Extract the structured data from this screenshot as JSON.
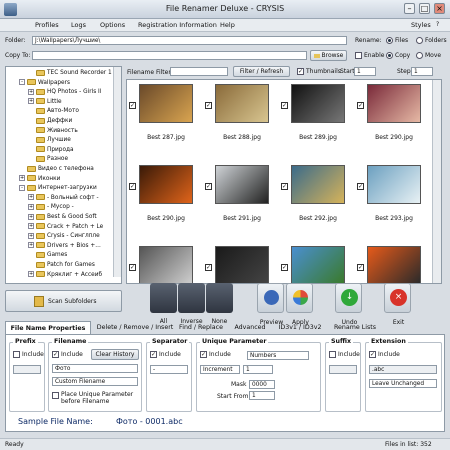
{
  "window": {
    "title": "File Renamer Deluxe - CRYSIS"
  },
  "menu": [
    "Profiles",
    "Logs",
    "Options",
    "Registration Information",
    "Help"
  ],
  "styles_label": "Styles",
  "folder": {
    "label": "Folder:",
    "value": "J:\\Wallpapers\\Лучшие\\"
  },
  "copyto": {
    "label": "Copy To:",
    "value": "",
    "browse": "Browse"
  },
  "rename_opts": {
    "label": "Rename:",
    "files": "Files",
    "folders": "Folders"
  },
  "copy_opts": {
    "enable": "Enable",
    "copy": "Copy",
    "move": "Move"
  },
  "filter": {
    "label": "Filename Filter:",
    "value": "",
    "btn": "Filter / Refresh"
  },
  "thumbs": {
    "label": "Thumbnails",
    "start_label": "Start",
    "start": "1",
    "step_label": "Step",
    "step": "1"
  },
  "tree": [
    {
      "text": "TEC Sound Recorder 1",
      "indent": 2,
      "exp": ""
    },
    {
      "text": "Wallpapers",
      "indent": 1,
      "exp": "-"
    },
    {
      "text": "HQ Photos - Girls Il",
      "indent": 2,
      "exp": "+"
    },
    {
      "text": "Little",
      "indent": 2,
      "exp": "+"
    },
    {
      "text": "Авто-Мото",
      "indent": 2,
      "exp": ""
    },
    {
      "text": "Деффки",
      "indent": 2,
      "exp": ""
    },
    {
      "text": "Живность",
      "indent": 2,
      "exp": ""
    },
    {
      "text": "Лучшие",
      "indent": 2,
      "exp": ""
    },
    {
      "text": "Природа",
      "indent": 2,
      "exp": ""
    },
    {
      "text": "Разное",
      "indent": 2,
      "exp": ""
    },
    {
      "text": "Видео с телефона",
      "indent": 1,
      "exp": ""
    },
    {
      "text": "Иконки",
      "indent": 1,
      "exp": "+"
    },
    {
      "text": "Интернет-загрузки",
      "indent": 1,
      "exp": "-"
    },
    {
      "text": "- Вольный софт -",
      "indent": 2,
      "exp": "+"
    },
    {
      "text": "- Мусор -",
      "indent": 2,
      "exp": "+"
    },
    {
      "text": "Best & Good Soft",
      "indent": 2,
      "exp": "+"
    },
    {
      "text": "Crack + Patch + Le",
      "indent": 2,
      "exp": "+"
    },
    {
      "text": "Crysis - Синглпле",
      "indent": 2,
      "exp": "+"
    },
    {
      "text": "Drivers + Bios +...",
      "indent": 2,
      "exp": "+"
    },
    {
      "text": "Games",
      "indent": 2,
      "exp": ""
    },
    {
      "text": "Patch for Games",
      "indent": 2,
      "exp": ""
    },
    {
      "text": "Кряклиг + Ассеиб",
      "indent": 2,
      "exp": "+"
    }
  ],
  "thumbnails": [
    {
      "name": "Best 287.jpg",
      "c1": "#6a4a2a",
      "c2": "#d9a450"
    },
    {
      "name": "Best 288.jpg",
      "c1": "#8a6b3a",
      "c2": "#d8c590"
    },
    {
      "name": "Best 289.jpg",
      "c1": "#111111",
      "c2": "#777777"
    },
    {
      "name": "Best 290.jpg",
      "c1": "#7a2a3a",
      "c2": "#e6b9a5"
    },
    {
      "name": "Best 290.jpg",
      "c1": "#3a1a08",
      "c2": "#e0641a"
    },
    {
      "name": "Best 291.jpg",
      "c1": "#cfd3d6",
      "c2": "#222222"
    },
    {
      "name": "Best 292.jpg",
      "c1": "#3b6b8a",
      "c2": "#d6b35a"
    },
    {
      "name": "Best 293.jpg",
      "c1": "#6ca0c0",
      "c2": "#e8f1f4"
    },
    {
      "name": "",
      "c1": "#555555",
      "c2": "#cfcfcf"
    },
    {
      "name": "",
      "c1": "#1a1a1a",
      "c2": "#444444"
    },
    {
      "name": "",
      "c1": "#4a8fd0",
      "c2": "#3a7a2a"
    },
    {
      "name": "",
      "c1": "#e65a1a",
      "c2": "#2a2a2a"
    }
  ],
  "actions": {
    "scan": "Scan Subfolders",
    "all": "All",
    "inverse": "Inverse",
    "none": "None",
    "preview": "Preview",
    "apply": "Apply",
    "undo": "Undo",
    "exit": "Exit"
  },
  "tabs": [
    "File Name Properties",
    "Delete / Remove / Insert",
    "Find / Replace",
    "Advanced",
    "ID3v1 / ID3v2",
    "Rename Lists"
  ],
  "props": {
    "prefix": {
      "title": "Prefix",
      "include": "Include"
    },
    "filename": {
      "title": "Filename",
      "include": "Include",
      "clear": "Clear History",
      "value": "Фото",
      "mode": "Custom Filename",
      "place": "Place Unique Parameter before Filename"
    },
    "separator": {
      "title": "Separator",
      "include": "Include",
      "value": "-"
    },
    "unique": {
      "title": "Unique Parameter",
      "include": "Include",
      "type": "Numbers",
      "inc_label": "Increment",
      "inc": "1",
      "mask_label": "Mask",
      "mask": "0000",
      "start_label": "Start From",
      "start": "1"
    },
    "suffix": {
      "title": "Suffix",
      "include": "Include"
    },
    "extension": {
      "title": "Extension",
      "include": "Include",
      "value": ".abc",
      "mode": "Leave Unchanged"
    }
  },
  "sample": {
    "label": "Sample File Name:",
    "value": "Фото - 0001.abc"
  },
  "status": {
    "left": "Ready",
    "right": "Files in list: 352"
  },
  "colors": {
    "undo": "#2fa83a",
    "exit": "#d8332a",
    "preview": "#3a68b8"
  }
}
